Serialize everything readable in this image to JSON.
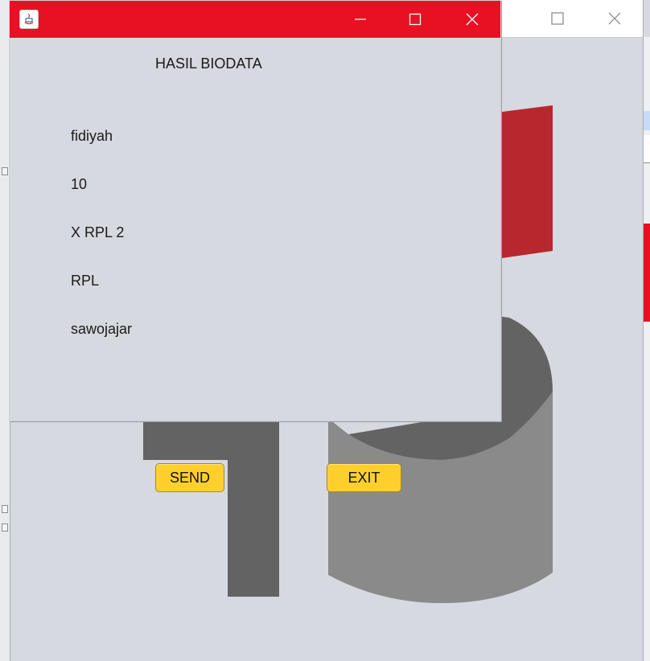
{
  "dialog": {
    "heading": "HASIL BIODATA",
    "values": [
      "fidiyah",
      "10",
      "X RPL 2",
      "RPL",
      "sawojajar"
    ],
    "title_bar_color": "#e81123",
    "icons": [
      "java-app-icon",
      "minimize-icon",
      "maximize-icon",
      "close-icon"
    ]
  },
  "main_window": {
    "send_label": "SEND",
    "exit_label": "EXIT",
    "button_color": "#ffd02d",
    "icons": [
      "maximize-icon",
      "close-icon"
    ]
  }
}
